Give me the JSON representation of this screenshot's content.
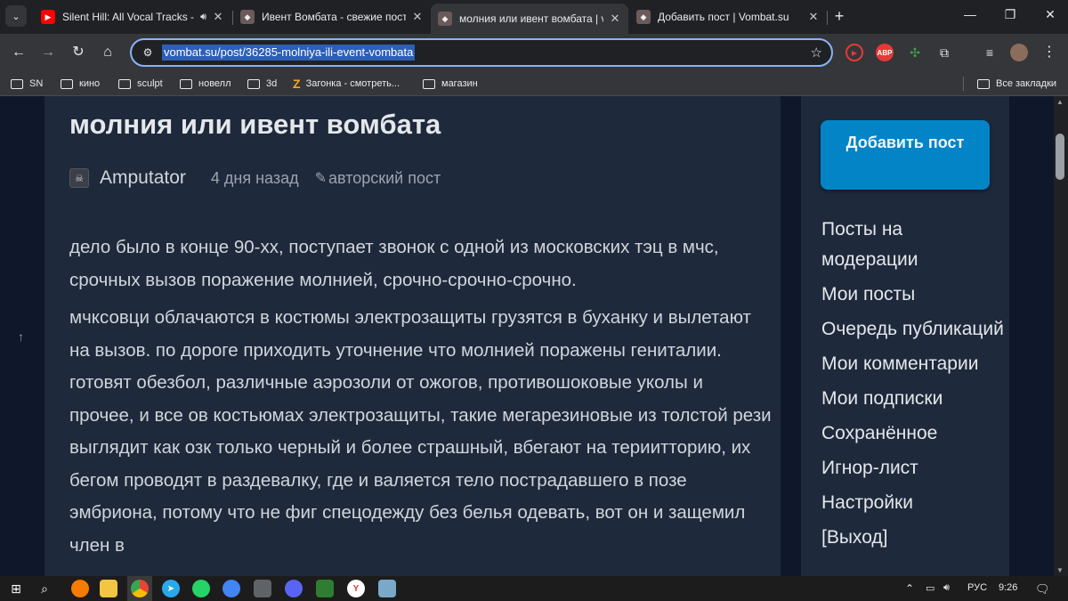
{
  "browser": {
    "tabs": [
      {
        "title": "Silent Hill: All Vocal Tracks -",
        "icon": "youtube-icon",
        "audio": true,
        "active": false
      },
      {
        "title": "Ивент Вомбата - свежие посты",
        "icon": "wombat-icon",
        "active": false
      },
      {
        "title": "молния или ивент вомбата | vo",
        "icon": "wombat-icon",
        "active": true
      },
      {
        "title": "Добавить пост | Vombat.su",
        "icon": "wombat-icon",
        "active": false
      }
    ],
    "address": "vombat.su/post/36285-molniya-ili-event-vombata",
    "extensions": [
      {
        "name": "record-icon",
        "color": "#e53935"
      },
      {
        "name": "abp-icon",
        "label": "ABP",
        "color": "#e53935"
      },
      {
        "name": "color-picker-icon",
        "color": "#43a047"
      },
      {
        "name": "puzzle-icon",
        "color": "#5f6368"
      },
      {
        "name": "media-icon",
        "color": "#5f6368"
      },
      {
        "name": "avatar-icon",
        "color": "#8a6d5b"
      }
    ],
    "bookmarks": [
      {
        "label": "SN",
        "icon": "folder-icon"
      },
      {
        "label": "кино",
        "icon": "folder-icon"
      },
      {
        "label": "sculpt",
        "icon": "folder-icon"
      },
      {
        "label": "новелл",
        "icon": "folder-icon"
      },
      {
        "label": "3d",
        "icon": "folder-icon"
      },
      {
        "label": "Загонка - смотреть...",
        "icon": "z-logo-icon"
      },
      {
        "label": "магазин",
        "icon": "folder-icon"
      }
    ],
    "all_bookmarks": "Все закладки"
  },
  "post": {
    "title": "молния или ивент вомбата",
    "author": "Amputator",
    "time": "4 дня назад",
    "badge": "авторский пост",
    "paragraphs": [
      "дело было в конце 90-хх, поступает звонок с одной из московских тэц в мчс, срочных вызов поражение молнией, срочно-срочно-срочно.",
      "мчксовци облачаются в костюмы электрозащиты грузятся в буханку и вылетают на вызов. по дороге приходить уточнение что молнией поражены гениталии. готовят обезбол, различные аэрозоли от ожогов, противошоковые уколы и прочее, и все ов костьюмах электрозащиты, такие мегарезиновые из толстой рези выглядит как озк только черный и более страшный, вбегают на териитторию, их бегом проводят в раздевалку, где и валяется тело пострадавшего в позе эмбриона, потому что не фиг спецодежду без белья одевать, вот он и защемил член в"
    ]
  },
  "sidebar": {
    "add_post": "Добавить пост",
    "menu": [
      "Посты на модерации",
      "Мои посты",
      "Очередь публикаций",
      "Мои комментарии",
      "Мои подписки",
      "Сохранённое",
      "Игнор-лист",
      "Настройки",
      "[Выход]"
    ]
  },
  "taskbar": {
    "language": "РУС",
    "clock": "9:26"
  }
}
